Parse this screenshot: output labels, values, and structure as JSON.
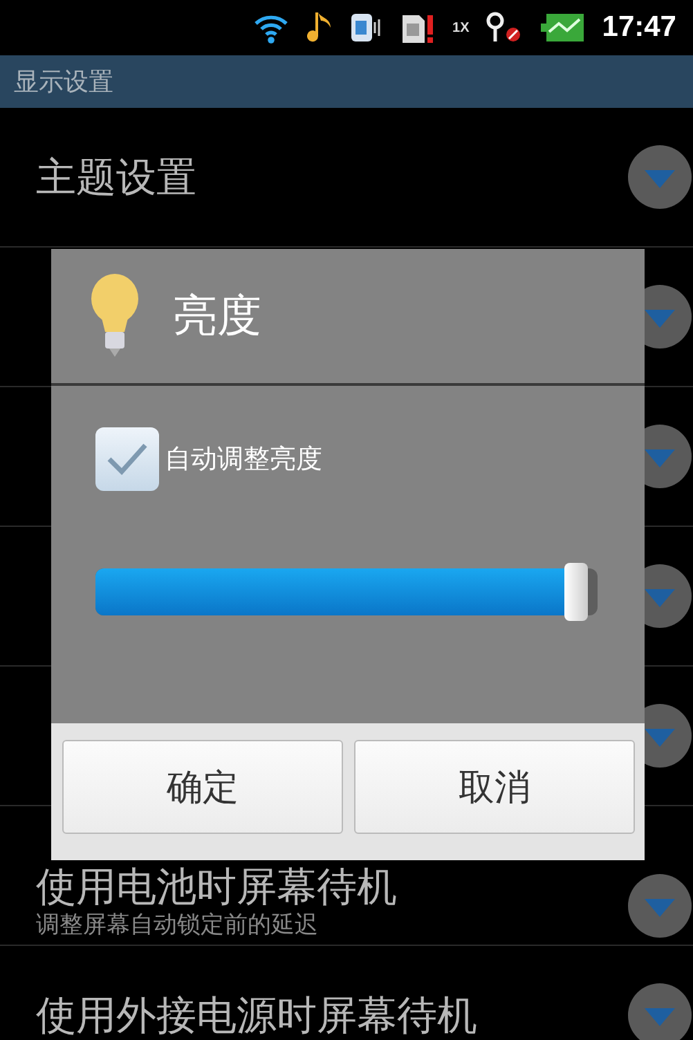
{
  "status_bar": {
    "time": "17:47",
    "signal_label": "1X"
  },
  "title_bar": {
    "title": "显示设置"
  },
  "settings": [
    {
      "title": "主题设置",
      "arrow": true
    },
    {
      "arrow": true
    },
    {
      "arrow": true
    },
    {
      "arrow": true
    },
    {
      "arrow": true
    },
    {
      "title": "使用电池时屏幕待机",
      "subtitle": "调整屏幕自动锁定前的延迟",
      "arrow": true
    },
    {
      "title": "使用外接电源时屏幕待机",
      "arrow": true
    }
  ],
  "dialog": {
    "title": "亮度",
    "auto_brightness": {
      "label": "自动调整亮度",
      "checked": true
    },
    "brightness": {
      "level": 0.98
    },
    "buttons": [
      "确定",
      "取消"
    ]
  }
}
